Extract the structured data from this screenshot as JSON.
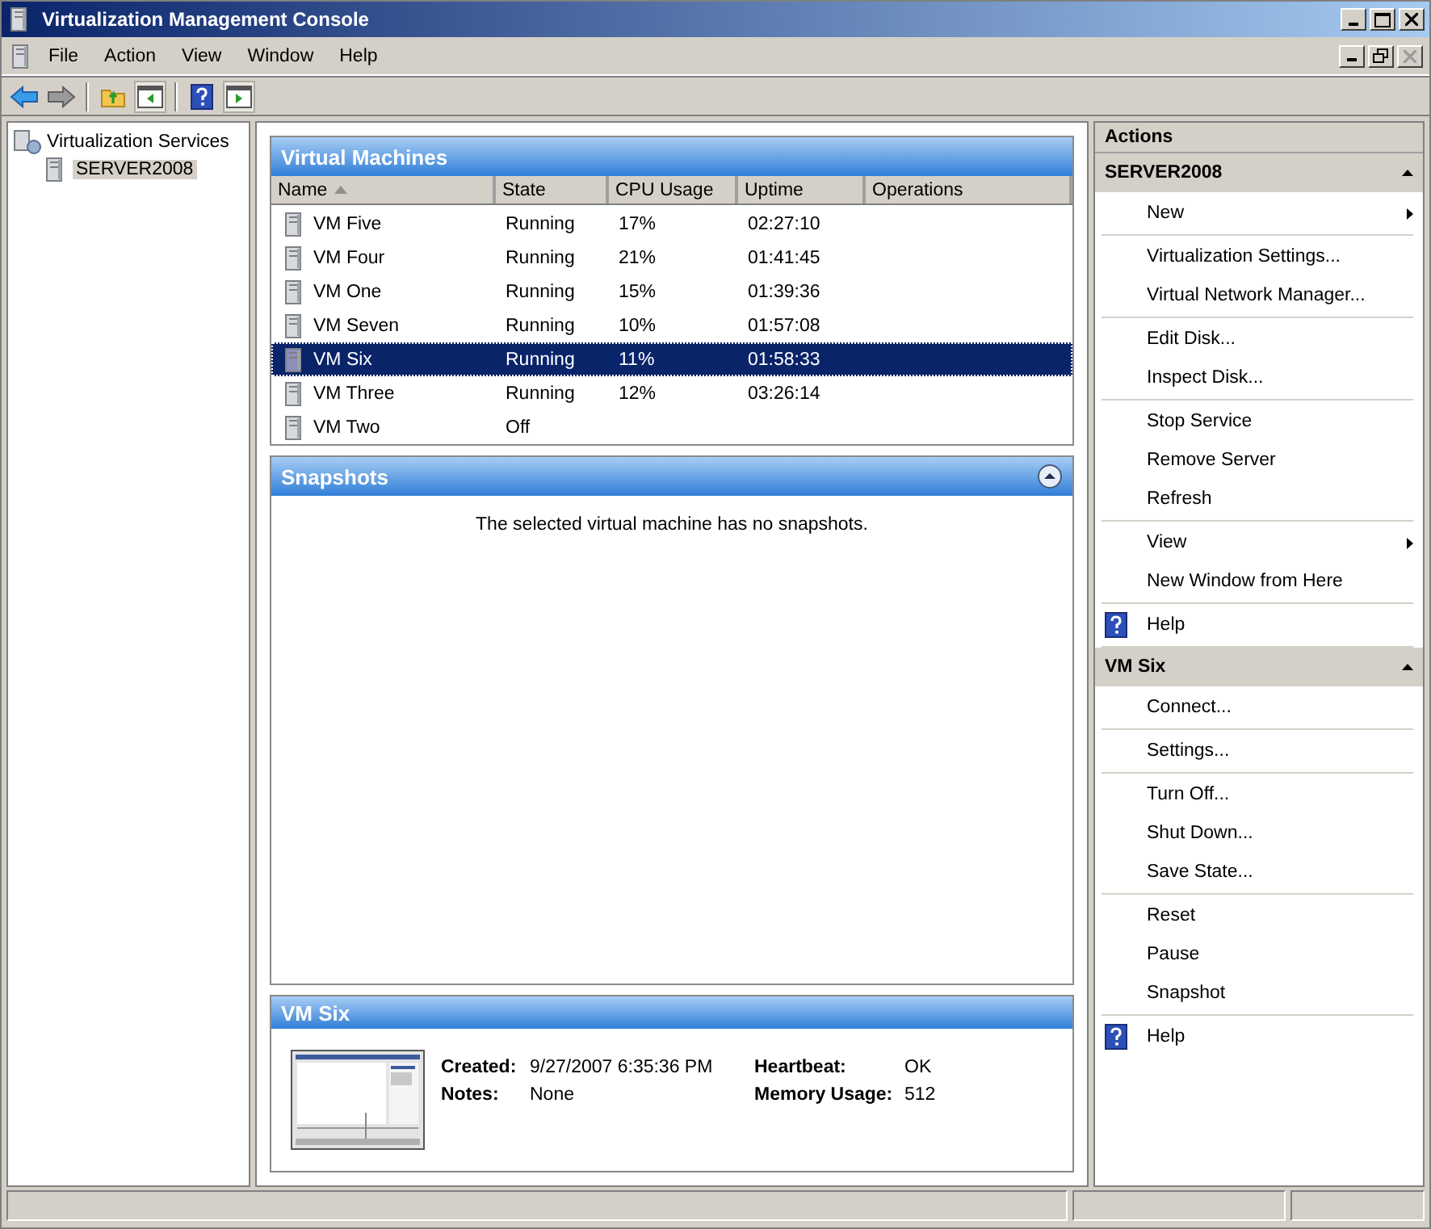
{
  "window": {
    "title": "Virtualization Management Console"
  },
  "menu": [
    "File",
    "Action",
    "View",
    "Window",
    "Help"
  ],
  "tree": {
    "label": "Virtualization Services",
    "children": [
      {
        "label": "SERVER2008",
        "selected": true
      }
    ]
  },
  "virtual_machines": {
    "title": "Virtual Machines",
    "columns": [
      {
        "label": "Name",
        "sorted": true
      },
      {
        "label": "State",
        "sorted": false
      },
      {
        "label": "CPU Usage",
        "sorted": false
      },
      {
        "label": "Uptime",
        "sorted": false
      },
      {
        "label": "Operations",
        "sorted": false
      }
    ],
    "rows": [
      {
        "name": "VM Five",
        "state": "Running",
        "cpu": "17%",
        "uptime": "02:27:10",
        "selected": false
      },
      {
        "name": "VM Four",
        "state": "Running",
        "cpu": "21%",
        "uptime": "01:41:45",
        "selected": false
      },
      {
        "name": "VM One",
        "state": "Running",
        "cpu": "15%",
        "uptime": "01:39:36",
        "selected": false
      },
      {
        "name": "VM Seven",
        "state": "Running",
        "cpu": "10%",
        "uptime": "01:57:08",
        "selected": false
      },
      {
        "name": "VM Six",
        "state": "Running",
        "cpu": "11%",
        "uptime": "01:58:33",
        "selected": true
      },
      {
        "name": "VM Three",
        "state": "Running",
        "cpu": "12%",
        "uptime": "03:26:14",
        "selected": false
      },
      {
        "name": "VM Two",
        "state": "Off",
        "selected": false
      }
    ]
  },
  "snapshots": {
    "title": "Snapshots",
    "collapsed": false,
    "message": "The selected virtual machine has no snapshots."
  },
  "details": {
    "title": "VM Six",
    "fields": [
      {
        "label": "Created:",
        "value": "9/27/2007 6:35:36 PM"
      },
      {
        "label": "Heartbeat:",
        "value": "OK"
      },
      {
        "label": "Notes:",
        "value": "None"
      },
      {
        "label": "Memory Usage:",
        "value": "512"
      }
    ]
  },
  "actions": {
    "title": "Actions",
    "sections": [
      {
        "title": "SERVER2008",
        "expanded": true,
        "groups": [
          [
            {
              "label": "New",
              "kind": "submenu"
            }
          ],
          [
            {
              "label": "Virtualization Settings...",
              "kind": "action"
            },
            {
              "label": "Virtual Network Manager...",
              "kind": "action"
            }
          ],
          [
            {
              "label": "Edit Disk...",
              "kind": "action"
            },
            {
              "label": "Inspect Disk...",
              "kind": "action"
            }
          ],
          [
            {
              "label": "Stop Service",
              "kind": "action"
            },
            {
              "label": "Remove Server",
              "kind": "action"
            },
            {
              "label": "Refresh",
              "kind": "action"
            }
          ],
          [
            {
              "label": "View",
              "kind": "submenu"
            },
            {
              "label": "New Window from Here",
              "kind": "action"
            }
          ],
          [
            {
              "label": "Help",
              "kind": "help"
            }
          ]
        ]
      },
      {
        "title": "VM Six",
        "expanded": true,
        "groups": [
          [
            {
              "label": "Connect...",
              "kind": "action"
            }
          ],
          [
            {
              "label": "Settings...",
              "kind": "action"
            }
          ],
          [
            {
              "label": "Turn Off...",
              "kind": "action"
            },
            {
              "label": "Shut Down...",
              "kind": "action"
            },
            {
              "label": "Save State...",
              "kind": "action"
            }
          ],
          [
            {
              "label": "Reset",
              "kind": "action"
            },
            {
              "label": "Pause",
              "kind": "action"
            },
            {
              "label": "Snapshot",
              "kind": "action"
            }
          ],
          [
            {
              "label": "Help",
              "kind": "help"
            }
          ]
        ]
      }
    ]
  }
}
